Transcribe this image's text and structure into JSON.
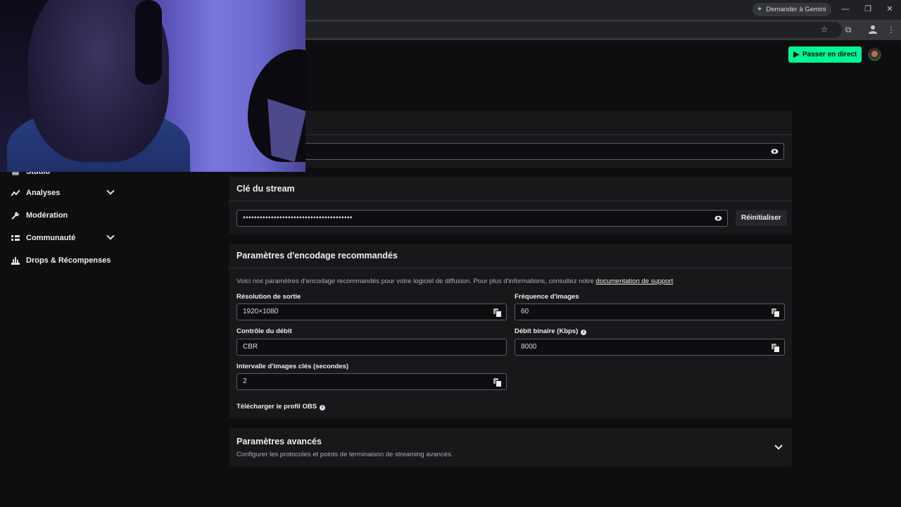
{
  "browser": {
    "gemini_label": "Demander à Gemini",
    "minimize": "—",
    "restore": "❐",
    "close": "✕",
    "star": "☆",
    "extensions": "⧉",
    "menu": "⋮"
  },
  "header": {
    "go_live_label": "Passer en direct"
  },
  "sidebar": {
    "items": [
      {
        "label": "Studio",
        "icon": "studio-icon"
      },
      {
        "label": "Analyses",
        "icon": "analytics-icon",
        "expandable": true
      },
      {
        "label": "Modération",
        "icon": "wrench-icon"
      },
      {
        "label": "Communauté",
        "icon": "community-icon",
        "expandable": true
      },
      {
        "label": "Drops & Récompenses",
        "icon": "gift-icon"
      }
    ]
  },
  "server_url": {
    "value": "••••••••••••••••••••••"
  },
  "stream_key": {
    "title": "Clé du stream",
    "value": "•••••••••••••••••••••••••••••••••••••••",
    "reset_label": "Réinitialiser"
  },
  "encoding": {
    "title": "Paramètres d'encodage recommandés",
    "desc": "Voici nos paramètres d'encodage recommandés pour votre logiciel de diffusion. Pour plus d'informations, consultez notre ",
    "desc_link": "documentation de support",
    "fields": {
      "resolution": {
        "label": "Résolution de sortie",
        "value": "1920×1080"
      },
      "framerate": {
        "label": "Fréquence d'images",
        "value": "60"
      },
      "rate_control": {
        "label": "Contrôle du débit",
        "value": "CBR"
      },
      "bitrate": {
        "label": "Débit binaire (Kbps)",
        "value": "8000"
      },
      "keyframe": {
        "label": "Intervalle d'images clés (secondes)",
        "value": "2"
      }
    },
    "download_obs": "Télécharger le profil OBS"
  },
  "advanced": {
    "title": "Paramètres avancés",
    "desc": "Configurer les protocoles et points de terminaison de streaming avancés."
  },
  "colors": {
    "accent_green": "#00f593",
    "page_bg": "#0e0e10",
    "card_bg": "#18181b"
  }
}
